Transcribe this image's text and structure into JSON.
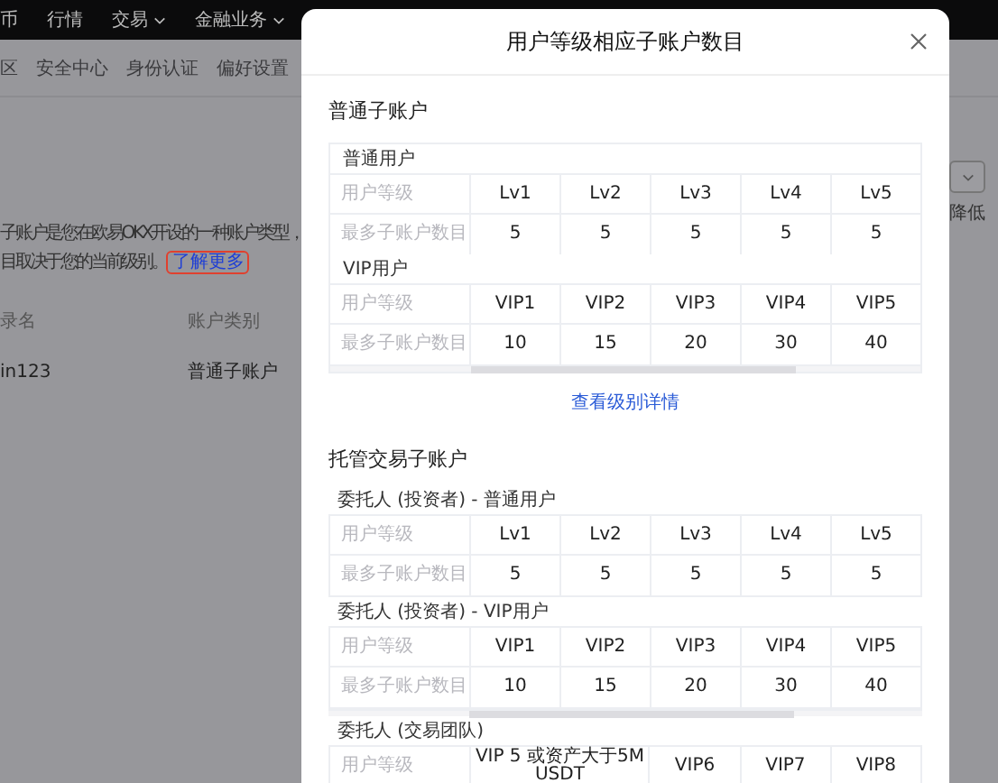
{
  "nav": [
    {
      "label": "币",
      "dropdown": false
    },
    {
      "label": "行情",
      "dropdown": false
    },
    {
      "label": "交易",
      "dropdown": true
    },
    {
      "label": "金融业务",
      "dropdown": true
    }
  ],
  "tabs": [
    "区",
    "安全中心",
    "身份认证",
    "偏好设置"
  ],
  "intro": [
    "子账户是您在欧易OKX开设的一种账户类型，",
    "目取决于您的当前级别。"
  ],
  "learn_more": "了解更多",
  "right_note": "降低",
  "list": {
    "columns": [
      "录名",
      "账户类别"
    ],
    "rows": [
      [
        "in123",
        "普通子账户"
      ]
    ]
  },
  "modal": {
    "title": "用户等级相应子账户数目",
    "sections": [
      {
        "title": "普通子账户",
        "kind": "boxed",
        "groups": [
          {
            "title": "普通用户",
            "kind": "standard",
            "scrollbar": false,
            "rows": [
              {
                "label": "用户等级",
                "cells": [
                  "Lv1",
                  "Lv2",
                  "Lv3",
                  "Lv4",
                  "Lv5"
                ]
              },
              {
                "label": "最多子账户数目",
                "cells": [
                  "5",
                  "5",
                  "5",
                  "5",
                  "5"
                ]
              }
            ]
          },
          {
            "title": "VIP用户",
            "kind": "standard",
            "scrollbar": true,
            "rows": [
              {
                "label": "用户等级",
                "cells": [
                  "VIP1",
                  "VIP2",
                  "VIP3",
                  "VIP4",
                  "VIP5"
                ]
              },
              {
                "label": "最多子账户数目",
                "cells": [
                  "10",
                  "15",
                  "20",
                  "30",
                  "40"
                ]
              }
            ]
          }
        ]
      },
      {
        "title": "托管交易子账户",
        "kind": "plain",
        "groups": [
          {
            "title": "委托人 (投资者) - 普通用户",
            "kind": "standard",
            "scrollbar": false,
            "rows": [
              {
                "label": "用户等级",
                "cells": [
                  "Lv1",
                  "Lv2",
                  "Lv3",
                  "Lv4",
                  "Lv5"
                ]
              },
              {
                "label": "最多子账户数目",
                "cells": [
                  "5",
                  "5",
                  "5",
                  "5",
                  "5"
                ]
              }
            ]
          },
          {
            "title": "委托人 (投资者) - VIP用户",
            "kind": "standard",
            "scrollbar": true,
            "rows": [
              {
                "label": "用户等级",
                "cells": [
                  "VIP1",
                  "VIP2",
                  "VIP3",
                  "VIP4",
                  "VIP5"
                ]
              },
              {
                "label": "最多子账户数目",
                "cells": [
                  "10",
                  "15",
                  "20",
                  "30",
                  "40"
                ]
              }
            ]
          },
          {
            "title": "委托人 (交易团队)",
            "kind": "merged",
            "scrollbar": false,
            "rows": [
              {
                "label": "用户等级",
                "cells": [
                  "VIP 5 或资产大于5M USDT",
                  "VIP6",
                  "VIP7",
                  "VIP8"
                ]
              }
            ]
          }
        ]
      }
    ],
    "link": "查看级别详情"
  }
}
